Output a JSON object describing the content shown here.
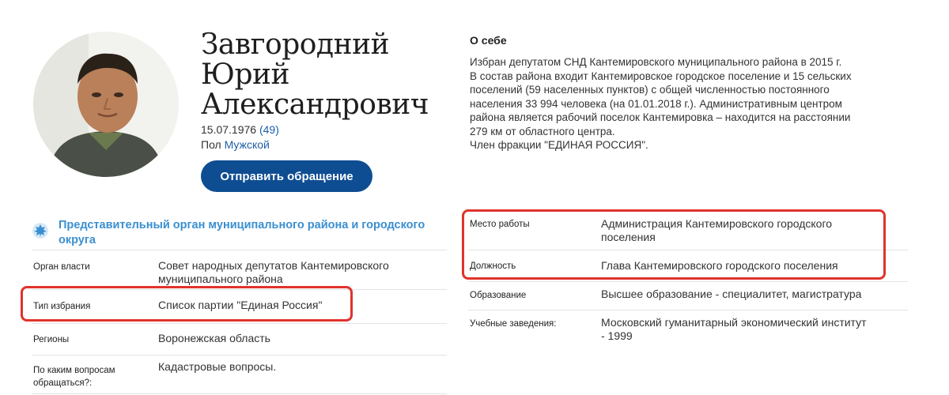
{
  "profile": {
    "name_line1": "Завгородний",
    "name_line2": "Юрий",
    "name_line3": "Александрович",
    "birth_date": "15.07.1976",
    "age": "(49)",
    "gender_label": "Пол",
    "gender_value": "Мужской",
    "send_button": "Отправить обращение"
  },
  "about": {
    "heading": "О себе",
    "lines": [
      "Избран депутатом СНД Кантемировского муниципального района в 2015 г.",
      "В состав района входит Кантемировское городское поселение и 15 сельских",
      "поселений (59 населенных пунктов) с общей численностью постоянного",
      "населения 33 994 человека (на 01.01.2018 г.). Административным центром",
      "района является рабочий поселок Кантемировка – находится на расстоянии",
      "279 км от областного центра.",
      "Член фракции \"ЕДИНАЯ РОССИЯ\"."
    ]
  },
  "organ": {
    "title_line1": "Представительный орган муниципального района и городского",
    "title_line2": "округа"
  },
  "left_table": [
    {
      "label": "Орган власти",
      "value_line1": "Совет народных депутатов Кантемировского",
      "value_line2": "муниципального района"
    },
    {
      "label": "Тип избрания",
      "value_line1": "Список партии \"Единая Россия\"",
      "value_line2": ""
    },
    {
      "label": "Регионы",
      "value_line1": "Воронежская область",
      "value_line2": ""
    },
    {
      "label_line1": "По каким вопросам",
      "label_line2": "обращаться?:",
      "value_line1": "Кадастровые вопросы.",
      "value_line2": ""
    }
  ],
  "right_table": [
    {
      "label": "Место работы",
      "value_line1": "Администрация Кантемировского городского",
      "value_line2": "поселения"
    },
    {
      "label": "Должность",
      "value_line1": "Глава Кантемировского городского поселения",
      "value_line2": ""
    },
    {
      "label": "Образование",
      "value_line1": "Высшее образование - специалитет, магистратура",
      "value_line2": ""
    },
    {
      "label": "Учебные заведения:",
      "value_line1": "Московский гуманитарный экономический институт",
      "value_line2": "- 1999"
    }
  ],
  "colors": {
    "button_bg": "#0f4d92",
    "link": "#1d5fa8",
    "org_title": "#3a8fd0",
    "highlight": "#e0332c"
  },
  "icons": {
    "org": "government-emblem-icon"
  }
}
